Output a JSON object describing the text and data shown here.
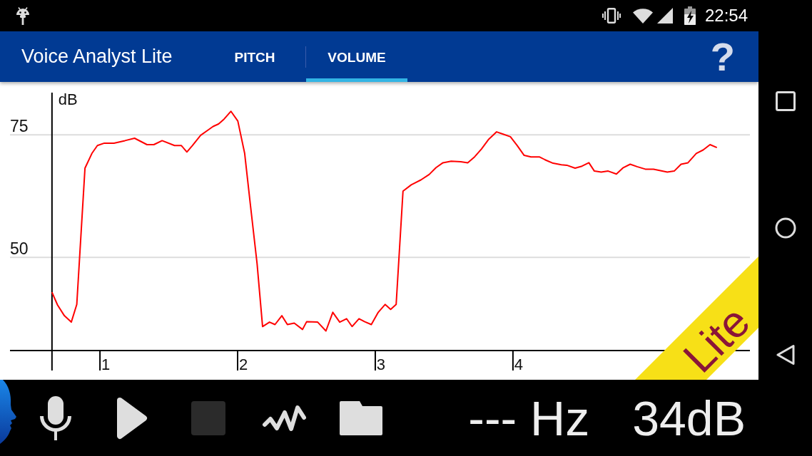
{
  "status_bar": {
    "time": "22:54"
  },
  "app_bar": {
    "title": "Voice Analyst Lite",
    "tabs": [
      {
        "label": "PITCH",
        "selected": false
      },
      {
        "label": "VOLUME",
        "selected": true
      }
    ],
    "help": "?"
  },
  "chart": {
    "chart_data": {
      "type": "line",
      "ylabel": "dB",
      "x": [
        0.61,
        0.65,
        0.7,
        0.75,
        0.79,
        0.85,
        0.9,
        0.94,
        0.99,
        1.06,
        1.14,
        1.21,
        1.3,
        1.35,
        1.41,
        1.5,
        1.55,
        1.59,
        1.63,
        1.69,
        1.74,
        1.78,
        1.82,
        1.86,
        1.91,
        1.96,
        2.01,
        2.05,
        2.1,
        2.14,
        2.19,
        2.23,
        2.28,
        2.32,
        2.37,
        2.43,
        2.46,
        2.54,
        2.6,
        2.65,
        2.7,
        2.75,
        2.79,
        2.84,
        2.88,
        2.93,
        2.98,
        3.03,
        3.07,
        3.11,
        3.16,
        3.22,
        3.29,
        3.35,
        3.4,
        3.45,
        3.51,
        3.58,
        3.63,
        3.68,
        3.73,
        3.78,
        3.84,
        3.89,
        3.94,
        3.99,
        4.04,
        4.09,
        4.15,
        4.2,
        4.25,
        4.31,
        4.35,
        4.41,
        4.46,
        4.51,
        4.55,
        4.6,
        4.65,
        4.71,
        4.76,
        4.81,
        4.86,
        4.92,
        4.98,
        5.03,
        5.08,
        5.13,
        5.18,
        5.23,
        5.29,
        5.34,
        5.39,
        5.44
      ],
      "series": [
        {
          "color": "#ff0000",
          "values": [
            42.9,
            40.3,
            38.1,
            36.8,
            40.4,
            68.2,
            71.2,
            72.8,
            73.3,
            73.3,
            73.8,
            74.3,
            73.0,
            73.0,
            73.8,
            72.8,
            72.8,
            71.5,
            72.8,
            74.9,
            75.9,
            76.7,
            77.2,
            78.2,
            79.8,
            77.8,
            71.2,
            61.0,
            48.7,
            35.9,
            36.8,
            36.3,
            38.1,
            36.3,
            36.6,
            35.3,
            36.9,
            36.8,
            35.0,
            38.8,
            36.8,
            37.5,
            35.9,
            37.5,
            36.9,
            36.3,
            38.8,
            40.4,
            39.4,
            40.4,
            63.5,
            64.8,
            65.8,
            66.9,
            68.3,
            69.3,
            69.6,
            69.5,
            69.3,
            70.5,
            72.1,
            74.0,
            75.6,
            75.1,
            74.6,
            72.8,
            70.8,
            70.5,
            70.5,
            69.8,
            69.2,
            68.9,
            68.8,
            68.2,
            68.6,
            69.3,
            67.6,
            67.4,
            67.6,
            67.0,
            68.3,
            69.0,
            68.5,
            68.0,
            68.0,
            67.7,
            67.4,
            67.6,
            69.0,
            69.3,
            71.2,
            71.9,
            73.0,
            72.4
          ]
        }
      ],
      "xlim": [
        0.305,
        5.68
      ],
      "ylim": [
        31,
        83.6
      ],
      "xticks": [
        1,
        2,
        3,
        4
      ],
      "yticks": [
        50,
        75
      ],
      "ref_lines": [
        {
          "axis": "x",
          "value": 0.61,
          "color": "#000000"
        }
      ]
    }
  },
  "ribbon": {
    "label": "Lite"
  },
  "toolbar": {
    "tools": [
      {
        "kind": "record",
        "disabled": false
      },
      {
        "kind": "play",
        "disabled": false
      },
      {
        "kind": "stop",
        "disabled": true
      },
      {
        "kind": "waveform",
        "disabled": false
      },
      {
        "kind": "folder",
        "disabled": false
      }
    ],
    "pitch_readout": "--- Hz",
    "volume_readout": "34dB"
  }
}
